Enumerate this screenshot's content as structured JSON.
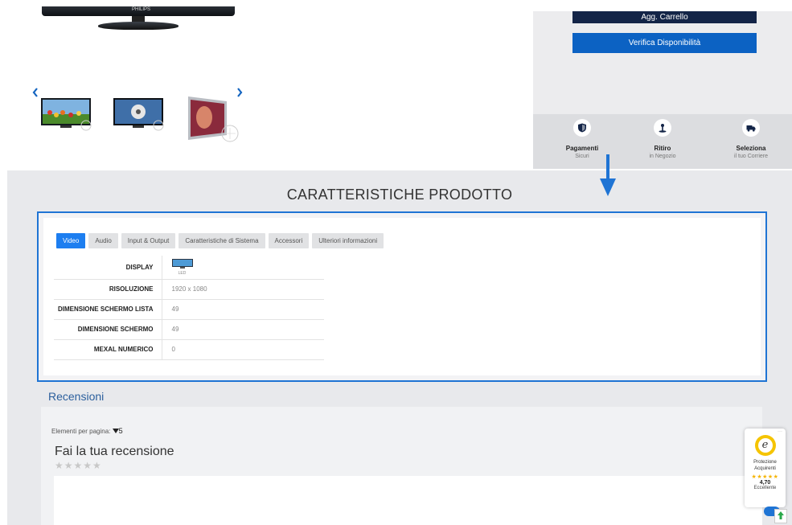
{
  "gallery": {
    "prev_icon": "chevron-left-icon",
    "next_icon": "chevron-right-icon",
    "brand": "PHILIPS"
  },
  "sidebar": {
    "cart_button": "Agg. Carrello",
    "verify_button": "Verifica Disponibilità",
    "features": [
      {
        "title": "Pagamenti",
        "subtitle": "Sicuri",
        "icon": "shield-icon"
      },
      {
        "title": "Ritiro",
        "subtitle": "in Negozio",
        "icon": "pickup-pin-icon"
      },
      {
        "title": "Seleziona",
        "subtitle": "il tuo Corriere",
        "icon": "truck-icon"
      }
    ]
  },
  "specs": {
    "title": "CARATTERISTICHE PRODOTTO",
    "tabs": [
      "Video",
      "Audio",
      "Input & Output",
      "Caratteristiche di Sistema",
      "Accessori",
      "Ulteriori informazioni"
    ],
    "active_tab": "Video",
    "rows": [
      {
        "label": "DISPLAY",
        "value": "LED"
      },
      {
        "label": "RISOLUZIONE",
        "value": "1920 x 1080"
      },
      {
        "label": "DIMENSIONE SCHERMO LISTA",
        "value": "49"
      },
      {
        "label": "DIMENSIONE SCHERMO",
        "value": "49"
      },
      {
        "label": "MEXAL NUMERICO",
        "value": "0"
      }
    ]
  },
  "reviews": {
    "title": "Recensioni",
    "per_page_label": "Elementi per pagina:",
    "per_page_value": "5",
    "write_title": "Fai la tua recensione",
    "stars": "★★★★★"
  },
  "badge": {
    "line1": "Protezione",
    "line2": "Acquirenti",
    "stars": "★★★★★",
    "rating": "4,70",
    "label": "Eccellente",
    "seal_letter": "e"
  },
  "colors": {
    "accent": "#1d7ef0",
    "navy": "#132447",
    "border_highlight": "#1f74d4"
  }
}
